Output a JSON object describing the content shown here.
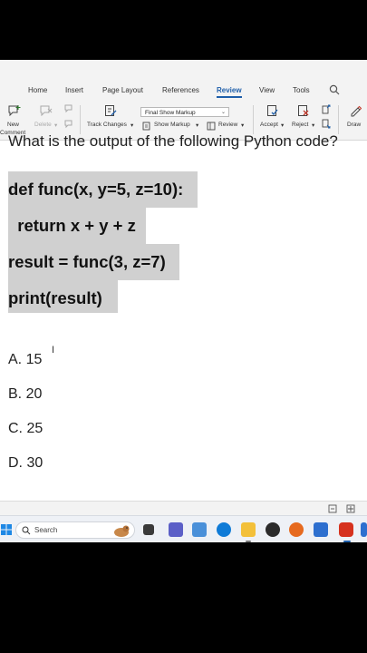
{
  "ribbon_tabs": [
    "Home",
    "Insert",
    "Page Layout",
    "References",
    "Review",
    "View",
    "Tools"
  ],
  "active_tab": "Review",
  "commands": {
    "new_comment": "New",
    "new_comment_2": "Comment",
    "delete": "Delete",
    "track_changes": "Track Changes",
    "markup_mode": "Final Show Markup",
    "show_markup": "Show Markup",
    "review": "Review",
    "accept": "Accept",
    "reject": "Reject",
    "draw": "Draw"
  },
  "document": {
    "question": "What is the output of the following Python code?",
    "code_lines": [
      "def func(x, y=5, z=10):",
      "  return x + y + z",
      "result = func(3, z=7)",
      "print(result)"
    ],
    "options": [
      "A. 15",
      "B. 20",
      "C. 25",
      "D. 30"
    ]
  },
  "taskbar": {
    "search_placeholder": "Search"
  },
  "colors": {
    "accent": "#1f5faa",
    "code_highlight": "#d0d0d0",
    "ribbon_bg": "#f3f3f3"
  }
}
